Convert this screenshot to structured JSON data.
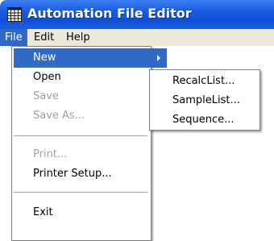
{
  "window": {
    "title": "Automation File Editor",
    "icon": "spreadsheet-icon"
  },
  "menubar": {
    "items": [
      "File",
      "Edit",
      "Help"
    ]
  },
  "file_menu": {
    "items": [
      {
        "label": "New",
        "enabled": true,
        "submenu": true,
        "selected": true
      },
      {
        "label": "Open",
        "enabled": true,
        "submenu": true
      },
      {
        "label": "Save",
        "enabled": false
      },
      {
        "label": "Save As...",
        "enabled": false
      },
      {
        "label": "Print...",
        "enabled": false
      },
      {
        "label": "Printer Setup...",
        "enabled": true
      },
      {
        "label": "Exit",
        "enabled": true
      }
    ]
  },
  "new_submenu": {
    "items": [
      "RecalcList...",
      "SampleList...",
      "Sequence..."
    ]
  },
  "colors": {
    "title_bar": "#1d5fe0",
    "highlight": "#316ac5",
    "disabled_text": "#a0a0a0",
    "menubar_bg": "#ece9d8"
  }
}
